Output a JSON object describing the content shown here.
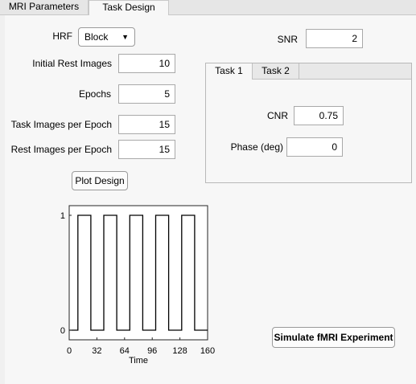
{
  "tabs": [
    {
      "label": "MRI Parameters",
      "active": false
    },
    {
      "label": "Task Design",
      "active": true
    }
  ],
  "form": {
    "hrf_label": "HRF",
    "hrf_value": "Block",
    "dropdown_icon": "triangle-down-icon",
    "initial_rest_label": "Initial Rest Images",
    "initial_rest_value": "10",
    "epochs_label": "Epochs",
    "epochs_value": "5",
    "task_images_label": "Task Images per Epoch",
    "task_images_value": "15",
    "rest_images_label": "Rest Images per Epoch",
    "rest_images_value": "15",
    "plot_button": "Plot Design",
    "snr_label": "SNR",
    "snr_value": "2"
  },
  "task_tabs": [
    {
      "label": "Task 1",
      "active": true
    },
    {
      "label": "Task 2",
      "active": false
    }
  ],
  "task": {
    "cnr_label": "CNR",
    "cnr_value": "0.75",
    "phase_label": "Phase (deg)",
    "phase_value": "0"
  },
  "simulate_button": "Simulate fMRI Experiment",
  "chart_data": {
    "type": "line",
    "title": "",
    "xlabel": "Time",
    "ylabel": "",
    "xlim": [
      0,
      160
    ],
    "ylim": [
      0,
      1
    ],
    "xticks": [
      "0",
      "32",
      "64",
      "96",
      "128",
      "160"
    ],
    "yticks": [
      "0",
      "1"
    ],
    "color": "#000000",
    "series": [
      {
        "x": [
          0,
          10,
          10,
          25,
          25,
          40,
          40,
          55,
          55,
          70,
          70,
          85,
          85,
          100,
          100,
          115,
          115,
          130,
          130,
          145,
          145,
          160
        ],
        "y": [
          0,
          0,
          1,
          1,
          0,
          0,
          1,
          1,
          0,
          0,
          1,
          1,
          0,
          0,
          1,
          1,
          0,
          0,
          1,
          1,
          0,
          0
        ]
      }
    ]
  }
}
